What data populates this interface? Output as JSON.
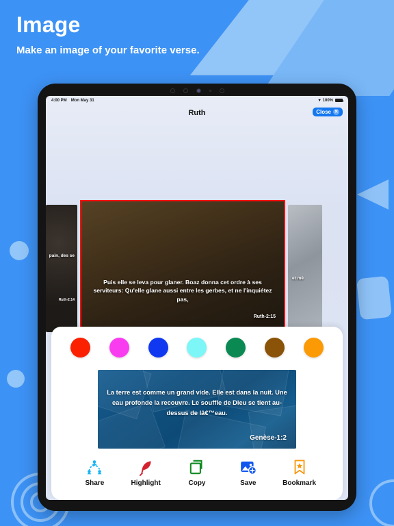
{
  "header": {
    "title": "Image",
    "subtitle": "Make an image of your favorite verse."
  },
  "device": {
    "statusbar": {
      "time": "4:00 PM",
      "date": "Mon May 31",
      "wifi_icon": "wifi-icon",
      "battery_percent": "100%",
      "battery_icon": "battery-full-icon"
    },
    "navbar": {
      "title": "Ruth",
      "close_label": "Close",
      "close_icon": "close-circle-icon"
    }
  },
  "carousel": {
    "prev_card": {
      "text": "pain, des se",
      "reference": "Ruth-2:14"
    },
    "selected_card": {
      "text": "Puis elle se leva pour glaner. Boaz donna cet ordre à ses serviteurs: Qu'elle glane aussi entre les gerbes, et ne l'inquiétez pas,",
      "reference": "Ruth-2:15",
      "border_color": "#ff1111"
    },
    "next_card": {
      "text": "et mê",
      "reference": ""
    }
  },
  "sheet": {
    "colors": [
      {
        "name": "red",
        "hex": "#fa2000"
      },
      {
        "name": "magenta",
        "hex": "#fa3cf0"
      },
      {
        "name": "blue",
        "hex": "#1038f0"
      },
      {
        "name": "cyan",
        "hex": "#7cf6f6"
      },
      {
        "name": "green",
        "hex": "#0a8a52"
      },
      {
        "name": "brown",
        "hex": "#8a5308"
      },
      {
        "name": "orange",
        "hex": "#fc9a06"
      }
    ],
    "preview": {
      "text": "La terre est comme un grand vide. Elle est dans la nuit. Une eau profonde la recouvre. Le souffle de Dieu se tient au-dessus de lâ€™eau.",
      "reference": "Genèse-1:2",
      "background_color": "#12537f"
    },
    "actions": [
      {
        "label": "Share",
        "icon": "share-network-icon",
        "color": "#19b4f5"
      },
      {
        "label": "Highlight",
        "icon": "feather-icon",
        "color": "#d32230"
      },
      {
        "label": "Copy",
        "icon": "copy-icon",
        "color": "#0f8a20"
      },
      {
        "label": "Save",
        "icon": "save-image-icon",
        "color": "#1057ef"
      },
      {
        "label": "Bookmark",
        "icon": "bookmark-star-icon",
        "color": "#f79a12"
      }
    ]
  }
}
